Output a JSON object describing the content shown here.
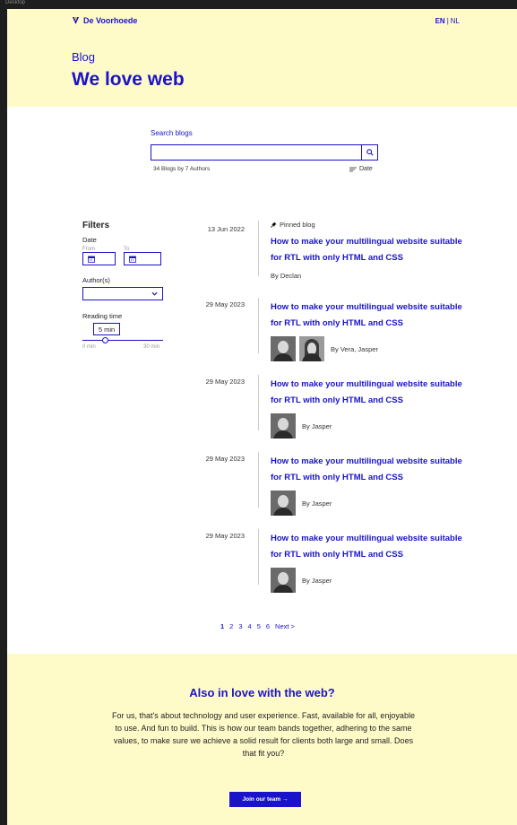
{
  "frame_label": "Desktop",
  "header": {
    "logo_text": "De Voorhoede",
    "lang_active": "EN",
    "lang_sep": "|",
    "lang_other": "NL"
  },
  "hero": {
    "subtitle": "Blog",
    "title": "We love web"
  },
  "search": {
    "label": "Search blogs",
    "placeholder": "",
    "value": "",
    "result_count": "34 Blogs by 7 Authors",
    "sort_label": "Date"
  },
  "filters": {
    "heading": "Filters",
    "date_label": "Date",
    "from_label": "From",
    "to_label": "To",
    "author_label": "Author(s)",
    "author_value": "",
    "reading_time_label": "Reading time",
    "reading_time_value": "5 min",
    "reading_time_fraction": 0.28,
    "min_label": "0 min",
    "max_label": "30 min"
  },
  "posts": [
    {
      "date": "13 Jun 2022",
      "pinned_label": "Pinned blog",
      "title": "How to make your multilingual website suitable for RTL with only HTML and CSS",
      "byline": "By Declan"
    },
    {
      "date": "29 May 2023",
      "title": "How to make your multilingual website suitable for RTL with only HTML and CSS",
      "byline": "By Vera, Jasper"
    },
    {
      "date": "29 May 2023",
      "title": "How to make your multilingual website suitable for RTL with only HTML and CSS",
      "byline": "By Jasper"
    },
    {
      "date": "29 May 2023",
      "title": "How to make your multilingual website suitable for RTL with only HTML and CSS",
      "byline": "By Jasper"
    },
    {
      "date": "29 May 2023",
      "title": "How to make your multilingual website suitable for RTL with only HTML and CSS",
      "byline": "By Jasper"
    }
  ],
  "pagination": {
    "pages": [
      "1",
      "2",
      "3",
      "4",
      "5",
      "6"
    ],
    "next": "Next >"
  },
  "cta": {
    "title": "Also in love with the web?",
    "text": "For us, that's about technology and user experience. Fast, available for all, enjoyable to use. And fun to build. This is how our team bands together, adhering to the same values, to make sure we achieve a solid result for clients both large and small. Does that fit you?",
    "button": "Join our team →"
  },
  "colors": {
    "accent": "#1a13c9",
    "hero_bg": "#fffbc9",
    "canvas_bg": "#1e1e1e"
  }
}
